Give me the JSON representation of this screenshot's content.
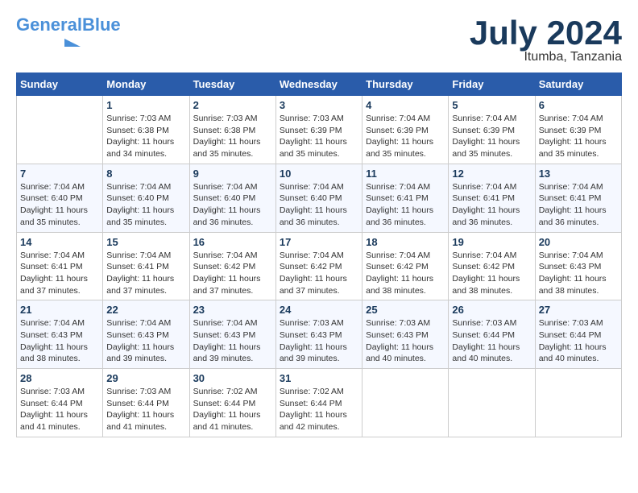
{
  "logo": {
    "part1": "General",
    "part2": "Blue"
  },
  "title": "July 2024",
  "location": "Itumba, Tanzania",
  "days_header": [
    "Sunday",
    "Monday",
    "Tuesday",
    "Wednesday",
    "Thursday",
    "Friday",
    "Saturday"
  ],
  "weeks": [
    [
      {
        "day": "",
        "sunrise": "",
        "sunset": "",
        "daylight": ""
      },
      {
        "day": "1",
        "sunrise": "Sunrise: 7:03 AM",
        "sunset": "Sunset: 6:38 PM",
        "daylight": "Daylight: 11 hours and 34 minutes."
      },
      {
        "day": "2",
        "sunrise": "Sunrise: 7:03 AM",
        "sunset": "Sunset: 6:38 PM",
        "daylight": "Daylight: 11 hours and 35 minutes."
      },
      {
        "day": "3",
        "sunrise": "Sunrise: 7:03 AM",
        "sunset": "Sunset: 6:39 PM",
        "daylight": "Daylight: 11 hours and 35 minutes."
      },
      {
        "day": "4",
        "sunrise": "Sunrise: 7:04 AM",
        "sunset": "Sunset: 6:39 PM",
        "daylight": "Daylight: 11 hours and 35 minutes."
      },
      {
        "day": "5",
        "sunrise": "Sunrise: 7:04 AM",
        "sunset": "Sunset: 6:39 PM",
        "daylight": "Daylight: 11 hours and 35 minutes."
      },
      {
        "day": "6",
        "sunrise": "Sunrise: 7:04 AM",
        "sunset": "Sunset: 6:39 PM",
        "daylight": "Daylight: 11 hours and 35 minutes."
      }
    ],
    [
      {
        "day": "7",
        "sunrise": "Sunrise: 7:04 AM",
        "sunset": "Sunset: 6:40 PM",
        "daylight": "Daylight: 11 hours and 35 minutes."
      },
      {
        "day": "8",
        "sunrise": "Sunrise: 7:04 AM",
        "sunset": "Sunset: 6:40 PM",
        "daylight": "Daylight: 11 hours and 35 minutes."
      },
      {
        "day": "9",
        "sunrise": "Sunrise: 7:04 AM",
        "sunset": "Sunset: 6:40 PM",
        "daylight": "Daylight: 11 hours and 36 minutes."
      },
      {
        "day": "10",
        "sunrise": "Sunrise: 7:04 AM",
        "sunset": "Sunset: 6:40 PM",
        "daylight": "Daylight: 11 hours and 36 minutes."
      },
      {
        "day": "11",
        "sunrise": "Sunrise: 7:04 AM",
        "sunset": "Sunset: 6:41 PM",
        "daylight": "Daylight: 11 hours and 36 minutes."
      },
      {
        "day": "12",
        "sunrise": "Sunrise: 7:04 AM",
        "sunset": "Sunset: 6:41 PM",
        "daylight": "Daylight: 11 hours and 36 minutes."
      },
      {
        "day": "13",
        "sunrise": "Sunrise: 7:04 AM",
        "sunset": "Sunset: 6:41 PM",
        "daylight": "Daylight: 11 hours and 36 minutes."
      }
    ],
    [
      {
        "day": "14",
        "sunrise": "Sunrise: 7:04 AM",
        "sunset": "Sunset: 6:41 PM",
        "daylight": "Daylight: 11 hours and 37 minutes."
      },
      {
        "day": "15",
        "sunrise": "Sunrise: 7:04 AM",
        "sunset": "Sunset: 6:41 PM",
        "daylight": "Daylight: 11 hours and 37 minutes."
      },
      {
        "day": "16",
        "sunrise": "Sunrise: 7:04 AM",
        "sunset": "Sunset: 6:42 PM",
        "daylight": "Daylight: 11 hours and 37 minutes."
      },
      {
        "day": "17",
        "sunrise": "Sunrise: 7:04 AM",
        "sunset": "Sunset: 6:42 PM",
        "daylight": "Daylight: 11 hours and 37 minutes."
      },
      {
        "day": "18",
        "sunrise": "Sunrise: 7:04 AM",
        "sunset": "Sunset: 6:42 PM",
        "daylight": "Daylight: 11 hours and 38 minutes."
      },
      {
        "day": "19",
        "sunrise": "Sunrise: 7:04 AM",
        "sunset": "Sunset: 6:42 PM",
        "daylight": "Daylight: 11 hours and 38 minutes."
      },
      {
        "day": "20",
        "sunrise": "Sunrise: 7:04 AM",
        "sunset": "Sunset: 6:43 PM",
        "daylight": "Daylight: 11 hours and 38 minutes."
      }
    ],
    [
      {
        "day": "21",
        "sunrise": "Sunrise: 7:04 AM",
        "sunset": "Sunset: 6:43 PM",
        "daylight": "Daylight: 11 hours and 38 minutes."
      },
      {
        "day": "22",
        "sunrise": "Sunrise: 7:04 AM",
        "sunset": "Sunset: 6:43 PM",
        "daylight": "Daylight: 11 hours and 39 minutes."
      },
      {
        "day": "23",
        "sunrise": "Sunrise: 7:04 AM",
        "sunset": "Sunset: 6:43 PM",
        "daylight": "Daylight: 11 hours and 39 minutes."
      },
      {
        "day": "24",
        "sunrise": "Sunrise: 7:03 AM",
        "sunset": "Sunset: 6:43 PM",
        "daylight": "Daylight: 11 hours and 39 minutes."
      },
      {
        "day": "25",
        "sunrise": "Sunrise: 7:03 AM",
        "sunset": "Sunset: 6:43 PM",
        "daylight": "Daylight: 11 hours and 40 minutes."
      },
      {
        "day": "26",
        "sunrise": "Sunrise: 7:03 AM",
        "sunset": "Sunset: 6:44 PM",
        "daylight": "Daylight: 11 hours and 40 minutes."
      },
      {
        "day": "27",
        "sunrise": "Sunrise: 7:03 AM",
        "sunset": "Sunset: 6:44 PM",
        "daylight": "Daylight: 11 hours and 40 minutes."
      }
    ],
    [
      {
        "day": "28",
        "sunrise": "Sunrise: 7:03 AM",
        "sunset": "Sunset: 6:44 PM",
        "daylight": "Daylight: 11 hours and 41 minutes."
      },
      {
        "day": "29",
        "sunrise": "Sunrise: 7:03 AM",
        "sunset": "Sunset: 6:44 PM",
        "daylight": "Daylight: 11 hours and 41 minutes."
      },
      {
        "day": "30",
        "sunrise": "Sunrise: 7:02 AM",
        "sunset": "Sunset: 6:44 PM",
        "daylight": "Daylight: 11 hours and 41 minutes."
      },
      {
        "day": "31",
        "sunrise": "Sunrise: 7:02 AM",
        "sunset": "Sunset: 6:44 PM",
        "daylight": "Daylight: 11 hours and 42 minutes."
      },
      {
        "day": "",
        "sunrise": "",
        "sunset": "",
        "daylight": ""
      },
      {
        "day": "",
        "sunrise": "",
        "sunset": "",
        "daylight": ""
      },
      {
        "day": "",
        "sunrise": "",
        "sunset": "",
        "daylight": ""
      }
    ]
  ]
}
